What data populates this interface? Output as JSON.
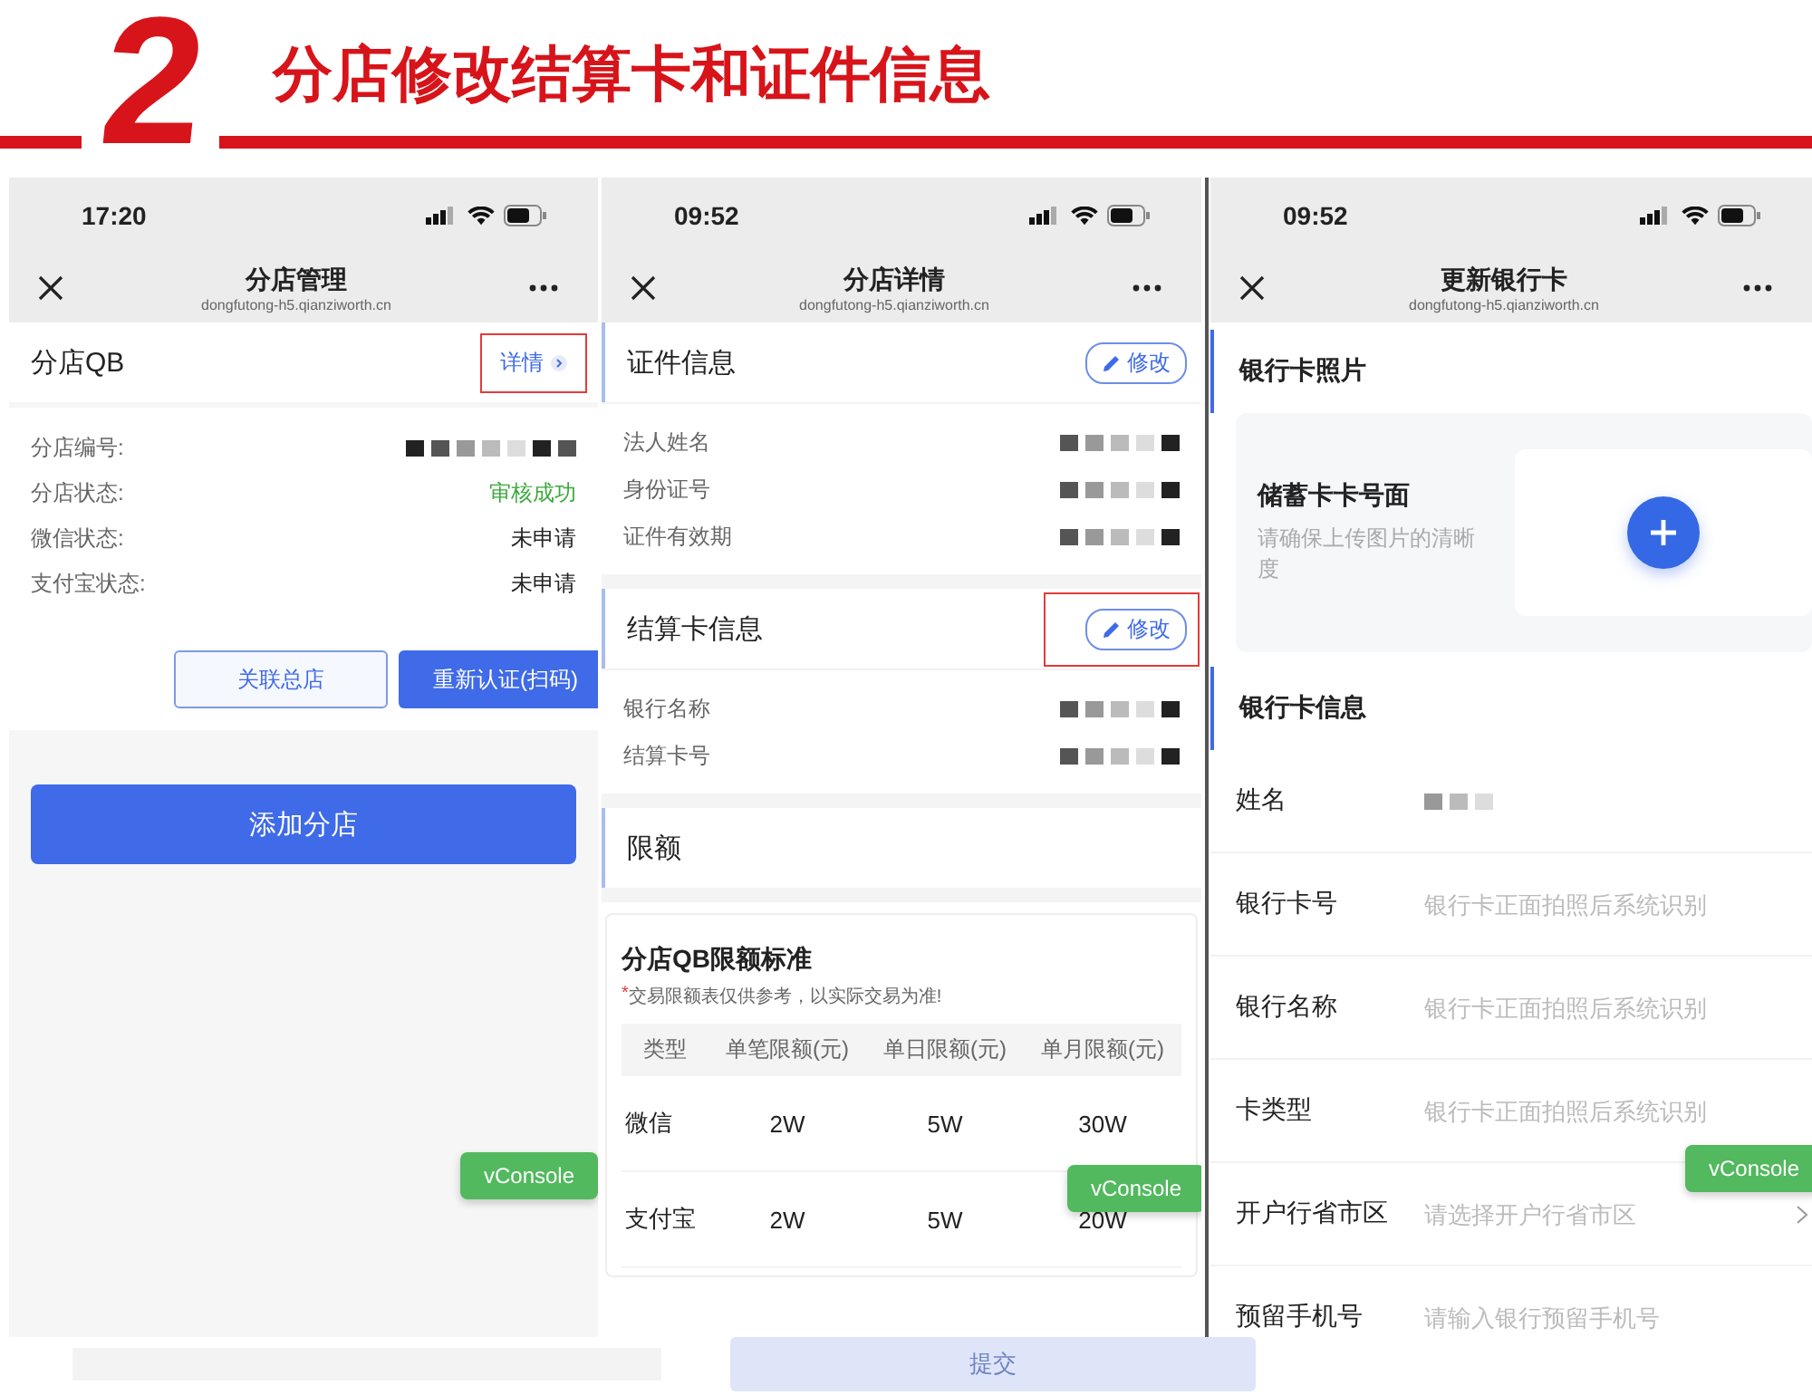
{
  "header": {
    "step": "2",
    "title": "分店修改结算卡和证件信息"
  },
  "screens": [
    {
      "kind": "branch_list",
      "time": "17:20",
      "nav_title": "分店管理",
      "url": "dongfutong-h5.qianziworth.cn",
      "store_name": "分店QB",
      "detail_link": {
        "label": "详情",
        "highlighted": true
      },
      "info_rows": [
        {
          "label": "分店编号:",
          "redacted": true
        },
        {
          "label": "分店状态:",
          "value": "审核成功",
          "success": true
        },
        {
          "label": "微信状态:",
          "value": "未申请",
          "success": false
        },
        {
          "label": "支付宝状态:",
          "value": "未申请",
          "success": false
        }
      ],
      "buttons": [
        {
          "label": "关联总店",
          "kind": "outline"
        },
        {
          "label": "重新认证(扫码)",
          "kind": "primary"
        }
      ],
      "add_button": "添加分店",
      "vconsole": "vConsole"
    },
    {
      "kind": "branch_detail",
      "time": "09:52",
      "nav_title": "分店详情",
      "url": "dongfutong-h5.qianziworth.cn",
      "sections": [
        {
          "title": "证件信息",
          "edit": {
            "label": "修改",
            "highlighted": false
          },
          "rows": [
            {
              "label": "法人姓名",
              "redacted": true
            },
            {
              "label": "身份证号",
              "redacted": true
            },
            {
              "label": "证件有效期",
              "redacted": true
            }
          ]
        },
        {
          "title": "结算卡信息",
          "edit": {
            "label": "修改",
            "highlighted": true
          },
          "rows": [
            {
              "label": "银行名称",
              "redacted": true
            },
            {
              "label": "结算卡号",
              "redacted": true
            }
          ]
        },
        {
          "title": "限额"
        }
      ],
      "limit_card": {
        "title": "分店QB限额标准",
        "note_mark": "*",
        "note": "交易限额表仅供参考，以实际交易为准!",
        "columns": [
          "类型",
          "单笔限额(元)",
          "单日限额(元)",
          "单月限额(元)"
        ],
        "rows": [
          [
            "微信",
            "2W",
            "5W",
            "30W"
          ],
          [
            "支付宝",
            "2W",
            "5W",
            "20W"
          ]
        ]
      },
      "vconsole": "vConsole"
    },
    {
      "kind": "bank_card",
      "time": "09:52",
      "nav_title": "更新银行卡",
      "url": "dongfutong-h5.qianziworth.cn",
      "photo_section": "银行卡照片",
      "upload": {
        "title": "储蓄卡卡号面",
        "hint": "请确保上传图片的清晰度"
      },
      "info_section": "银行卡信息",
      "fields": [
        {
          "label": "姓名",
          "kind": "text",
          "redacted": true
        },
        {
          "label": "银行卡号",
          "kind": "text",
          "placeholder": "银行卡正面拍照后系统识别"
        },
        {
          "label": "银行名称",
          "kind": "text",
          "placeholder": "银行卡正面拍照后系统识别"
        },
        {
          "label": "卡类型",
          "kind": "text",
          "placeholder": "银行卡正面拍照后系统识别"
        },
        {
          "label": "开户行省市区",
          "kind": "select",
          "placeholder": "请选择开户行省市区"
        },
        {
          "label": "预留手机号",
          "kind": "text",
          "placeholder": "请输入银行预留手机号"
        }
      ],
      "vconsole": "vConsole"
    }
  ],
  "footer": {
    "submit": "提交"
  }
}
